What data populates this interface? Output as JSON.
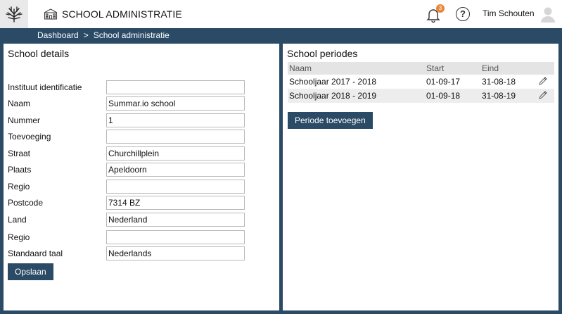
{
  "app": {
    "title": "SCHOOL ADMINISTRATIE",
    "notifications_count": "3",
    "help_glyph": "?",
    "user_name": "Tim Schouten"
  },
  "breadcrumb": {
    "items": [
      "Dashboard",
      "School administratie"
    ],
    "separator": ">"
  },
  "school_details": {
    "title": "School details",
    "fields": [
      {
        "label": "Instituut identificatie",
        "value": ""
      },
      {
        "label": "Naam",
        "value": "Summar.io school"
      },
      {
        "label": "Nummer",
        "value": "1"
      },
      {
        "label": "Toevoeging",
        "value": ""
      },
      {
        "label": "Straat",
        "value": "Churchillplein"
      },
      {
        "label": "Plaats",
        "value": "Apeldoorn"
      },
      {
        "label": "Regio",
        "value": ""
      },
      {
        "label": "Postcode",
        "value": "7314 BZ"
      },
      {
        "label": "Land",
        "value": "Nederland"
      },
      {
        "label": "Regio",
        "value": ""
      },
      {
        "label": "Standaard taal",
        "value": "Nederlands"
      }
    ],
    "save_label": "Opslaan"
  },
  "school_periods": {
    "title": "School periodes",
    "columns": [
      "Naam",
      "Start",
      "Eind"
    ],
    "rows": [
      {
        "name": "Schooljaar 2017 - 2018",
        "start": "01-09-17",
        "end": "31-08-18"
      },
      {
        "name": "Schooljaar 2018 - 2019",
        "start": "01-09-18",
        "end": "31-08-19"
      }
    ],
    "add_label": "Periode toevoegen"
  },
  "colors": {
    "accent": "#2b4a65",
    "badge": "#e8863a",
    "row_alt": "#ededed",
    "header_bg": "#e4e4e4"
  },
  "icons": {
    "logo": "tree-logo-icon",
    "school": "school-building-icon",
    "notifications": "bell-icon",
    "help": "help-icon",
    "avatar": "user-avatar-icon",
    "edit": "pencil-icon"
  }
}
